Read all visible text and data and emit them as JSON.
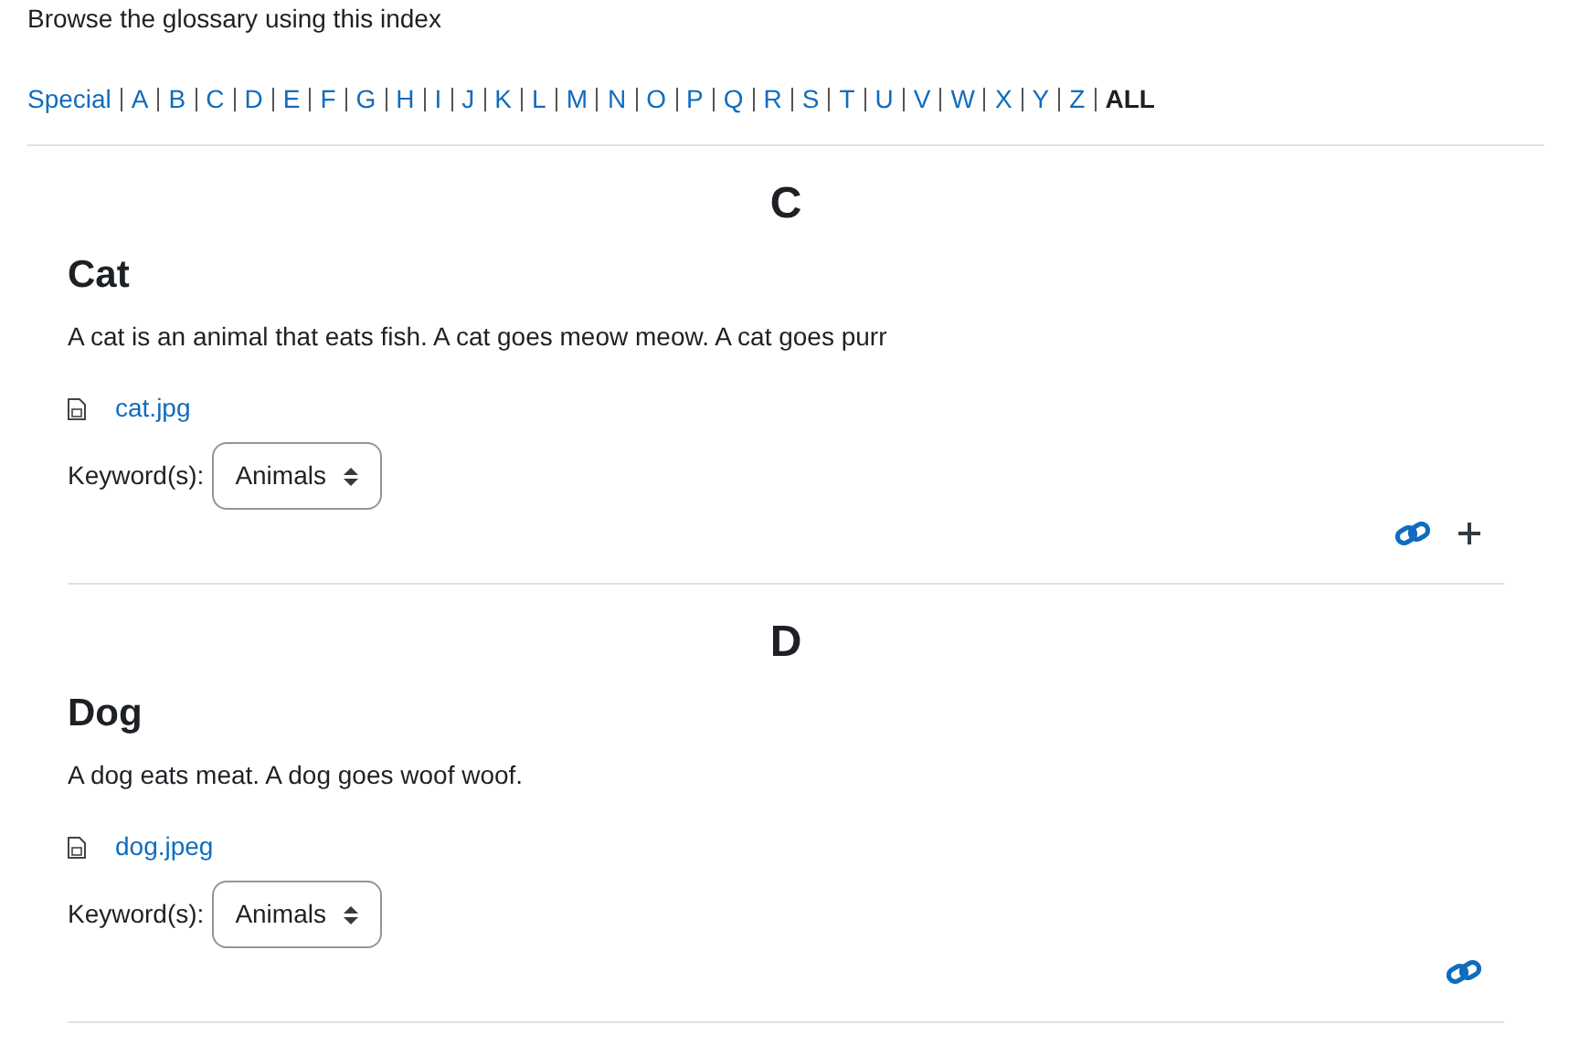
{
  "intro": "Browse the glossary using this index",
  "index": [
    {
      "label": "Special",
      "selected": false
    },
    {
      "label": "A",
      "selected": false
    },
    {
      "label": "B",
      "selected": false
    },
    {
      "label": "C",
      "selected": false
    },
    {
      "label": "D",
      "selected": false
    },
    {
      "label": "E",
      "selected": false
    },
    {
      "label": "F",
      "selected": false
    },
    {
      "label": "G",
      "selected": false
    },
    {
      "label": "H",
      "selected": false
    },
    {
      "label": "I",
      "selected": false
    },
    {
      "label": "J",
      "selected": false
    },
    {
      "label": "K",
      "selected": false
    },
    {
      "label": "L",
      "selected": false
    },
    {
      "label": "M",
      "selected": false
    },
    {
      "label": "N",
      "selected": false
    },
    {
      "label": "O",
      "selected": false
    },
    {
      "label": "P",
      "selected": false
    },
    {
      "label": "Q",
      "selected": false
    },
    {
      "label": "R",
      "selected": false
    },
    {
      "label": "S",
      "selected": false
    },
    {
      "label": "T",
      "selected": false
    },
    {
      "label": "U",
      "selected": false
    },
    {
      "label": "V",
      "selected": false
    },
    {
      "label": "W",
      "selected": false
    },
    {
      "label": "X",
      "selected": false
    },
    {
      "label": "Y",
      "selected": false
    },
    {
      "label": "Z",
      "selected": false
    },
    {
      "label": "ALL",
      "selected": true
    }
  ],
  "groups": [
    {
      "letter": "C",
      "entries": [
        {
          "term": "Cat",
          "definition": "A cat is an animal that eats fish. A cat goes meow meow. A cat goes purr",
          "attachment": "cat.jpg",
          "keyword_label": "Keyword(s):",
          "keyword": "Animals",
          "actions": [
            {
              "kind": "link"
            },
            {
              "kind": "add"
            }
          ]
        }
      ]
    },
    {
      "letter": "D",
      "entries": [
        {
          "term": "Dog",
          "definition": "A dog eats meat. A dog goes woof woof.",
          "attachment": "dog.jpeg",
          "keyword_label": "Keyword(s):",
          "keyword": "Animals",
          "actions": [
            {
              "kind": "link"
            }
          ]
        }
      ]
    }
  ]
}
